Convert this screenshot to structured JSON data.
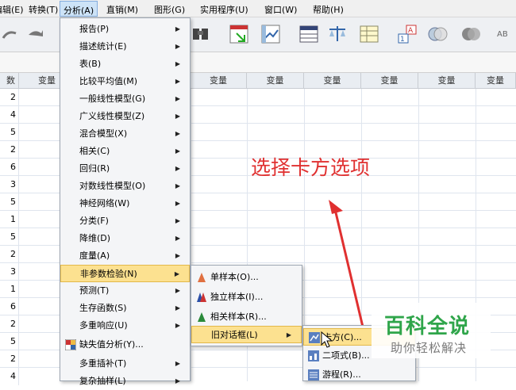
{
  "menubar": {
    "items": [
      {
        "label": "编辑(E)"
      },
      {
        "label": "转换(T)"
      },
      {
        "label": "分析(A)"
      },
      {
        "label": "直销(M)"
      },
      {
        "label": "图形(G)"
      },
      {
        "label": "实用程序(U)"
      },
      {
        "label": "窗口(W)"
      },
      {
        "label": "帮助(H)"
      }
    ]
  },
  "grid": {
    "first_col_header": "数",
    "col_header": "变量",
    "first_col_values": [
      "2",
      "4",
      "5",
      "2",
      "6",
      "3",
      "5",
      "1",
      "5",
      "2",
      "3",
      "1",
      "6",
      "2",
      "5",
      "2",
      "4"
    ]
  },
  "analyze_menu": {
    "items": [
      {
        "label": "报告(P)"
      },
      {
        "label": "描述统计(E)"
      },
      {
        "label": "表(B)"
      },
      {
        "label": "比较平均值(M)"
      },
      {
        "label": "一般线性模型(G)"
      },
      {
        "label": "广义线性模型(Z)"
      },
      {
        "label": "混合模型(X)"
      },
      {
        "label": "相关(C)"
      },
      {
        "label": "回归(R)"
      },
      {
        "label": "对数线性模型(O)"
      },
      {
        "label": "神经网络(W)"
      },
      {
        "label": "分类(F)"
      },
      {
        "label": "降维(D)"
      },
      {
        "label": "度量(A)"
      },
      {
        "label": "非参数检验(N)"
      },
      {
        "label": "预测(T)"
      },
      {
        "label": "生存函数(S)"
      },
      {
        "label": "多重响应(U)"
      },
      {
        "label": "缺失值分析(Y)..."
      },
      {
        "label": "多重插补(T)"
      },
      {
        "label": "复杂抽样(L)"
      }
    ]
  },
  "nonparam_menu": {
    "items": [
      {
        "label": "单样本(O)..."
      },
      {
        "label": "独立样本(I)..."
      },
      {
        "label": "相关样本(R)..."
      },
      {
        "label": "旧对话框(L)"
      }
    ]
  },
  "legacy_menu": {
    "items": [
      {
        "label": "卡方(C)..."
      },
      {
        "label": "二项式(B)..."
      },
      {
        "label": "游程(R)..."
      }
    ]
  },
  "annotation": {
    "text": "选择卡方选项"
  },
  "watermark": {
    "title": "百科全说",
    "subtitle": "助你轻松解决"
  },
  "colors": {
    "highlight": "#fce190",
    "annotation": "#e03030",
    "watermark": "#2fa54a"
  }
}
